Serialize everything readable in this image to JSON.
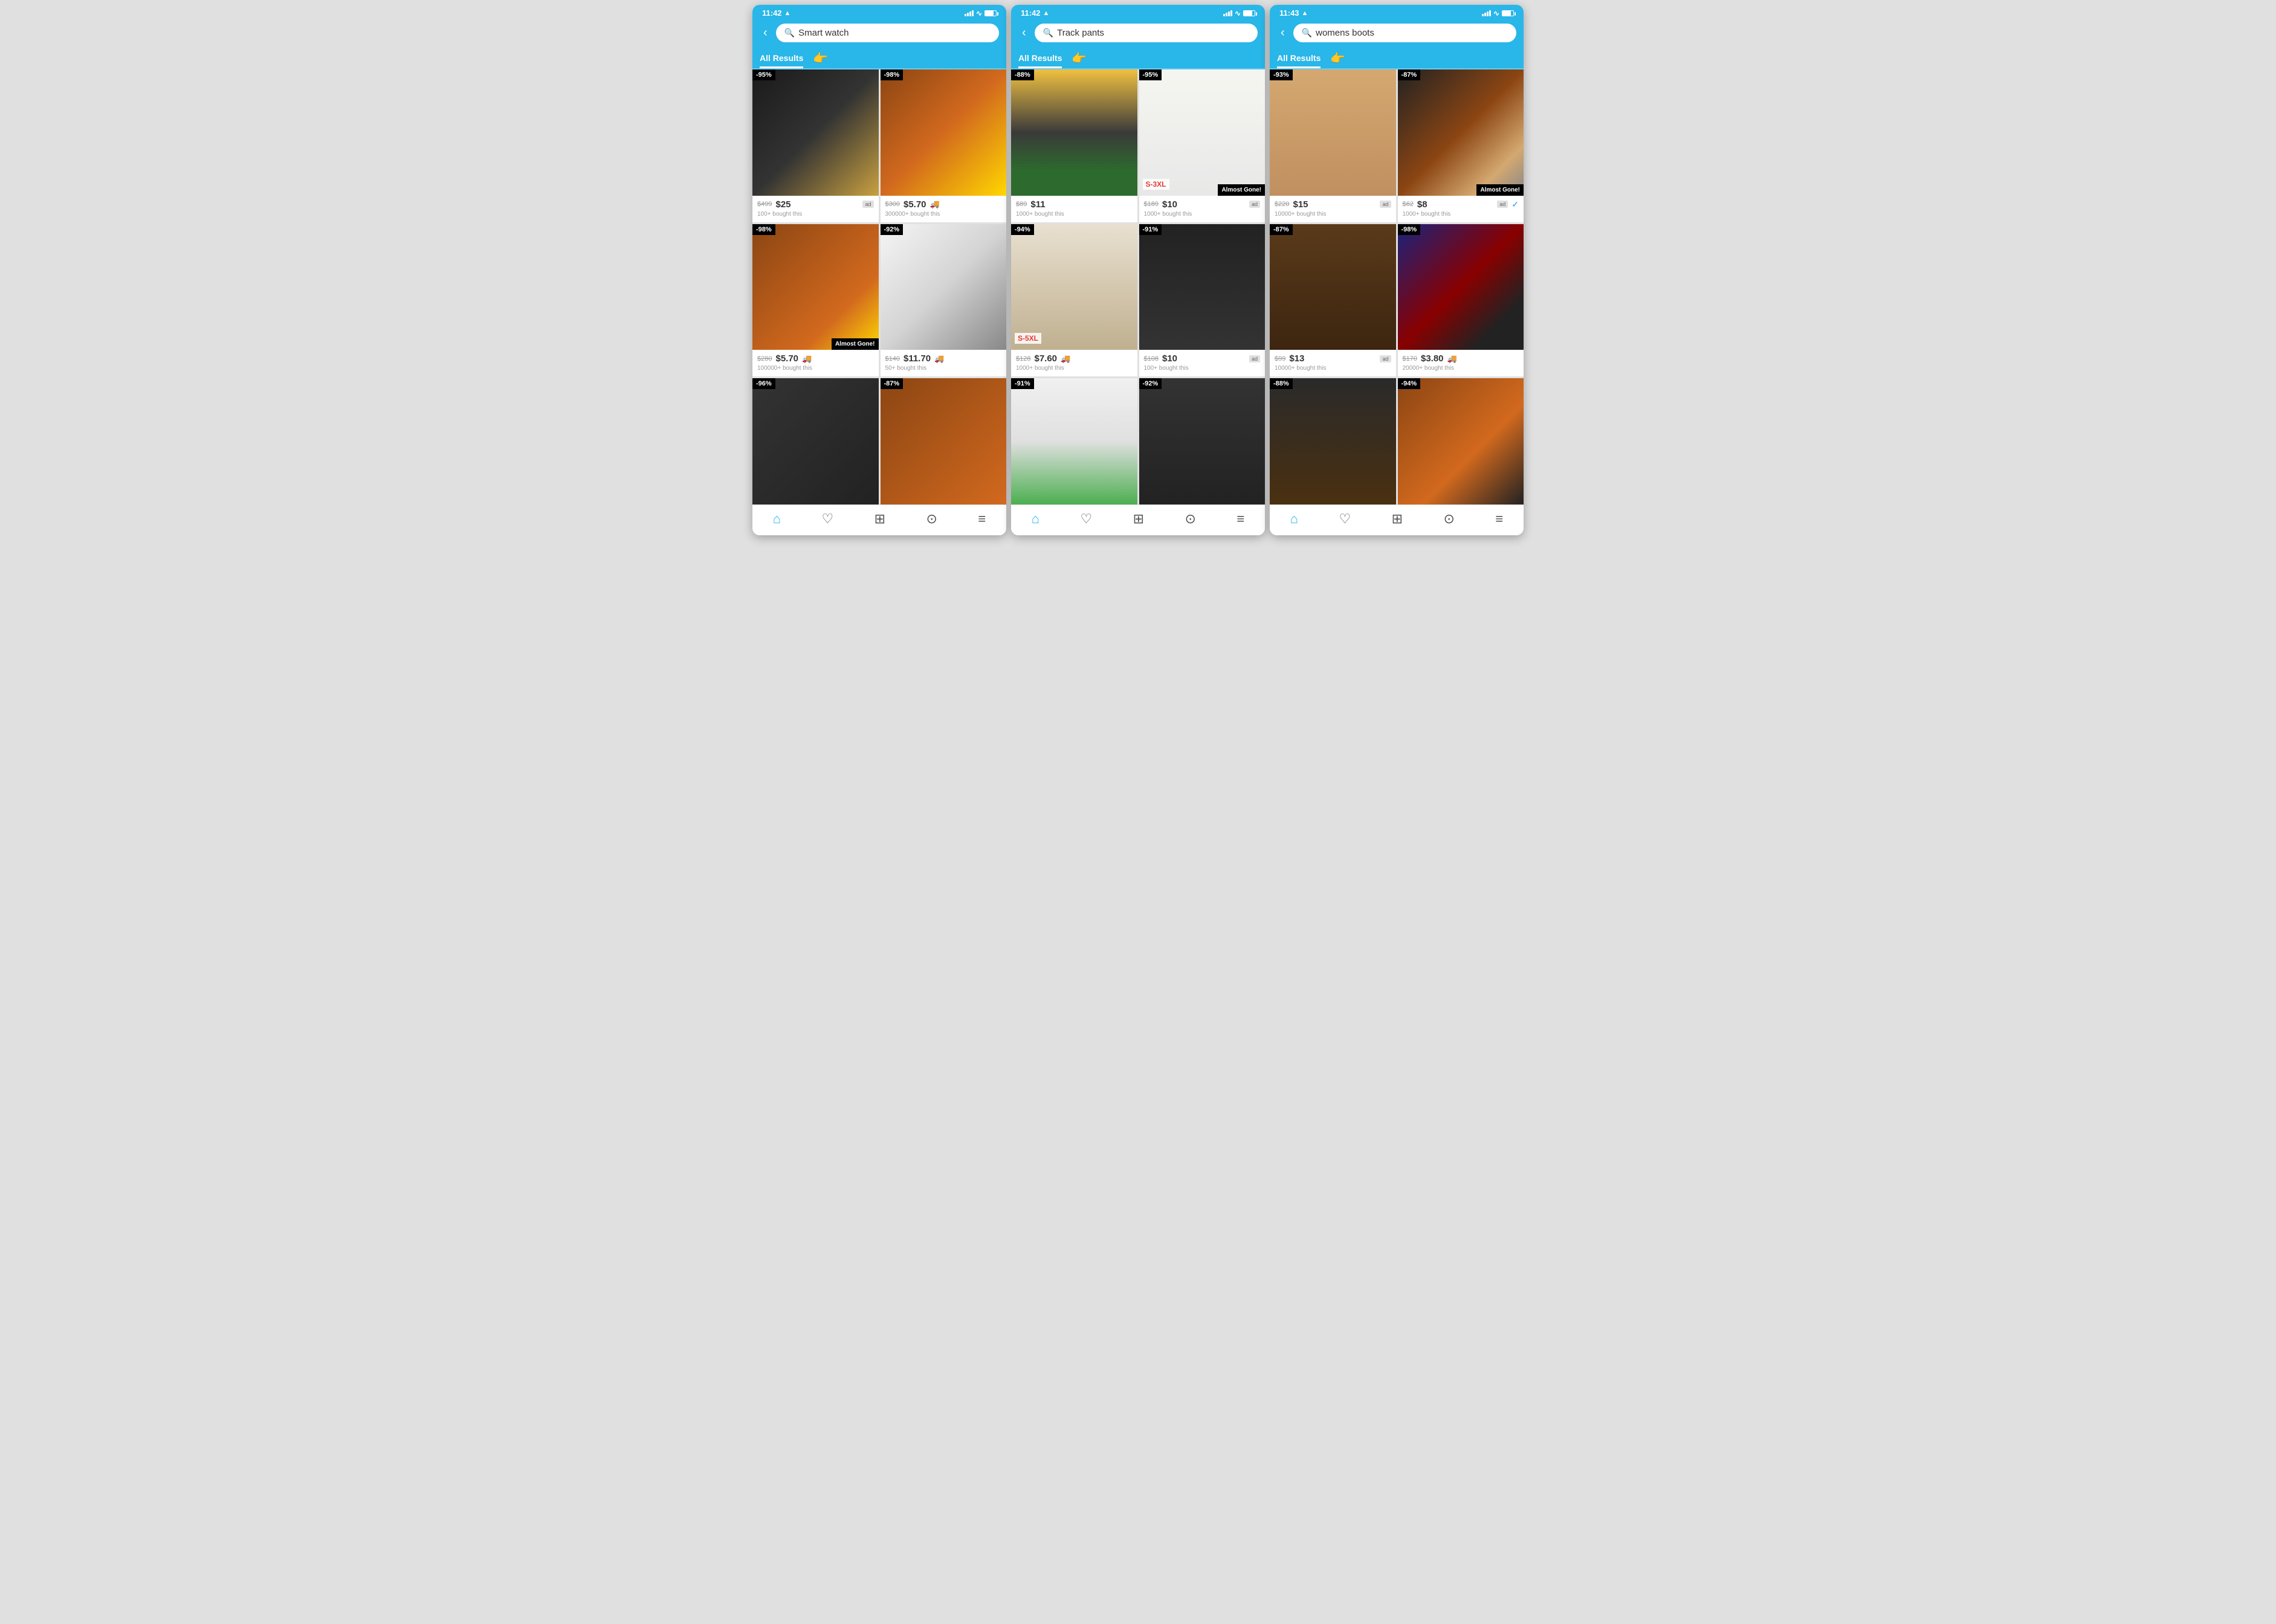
{
  "screens": [
    {
      "id": "smartwatch",
      "status_time": "11:42",
      "search_query": "Smart watch",
      "tab_label": "All Results",
      "products": [
        {
          "discount": "-95%",
          "original_price": "$499",
          "sale_price": "$25",
          "bought": "100+ bought this",
          "ad": true,
          "truck": false,
          "almost_gone": false,
          "bg": "watch-img-1"
        },
        {
          "discount": "-98%",
          "original_price": "$300",
          "sale_price": "$5.70",
          "bought": "300000+ bought this",
          "ad": false,
          "truck": true,
          "almost_gone": false,
          "bg": "watch-img-2"
        },
        {
          "discount": "-98%",
          "original_price": "$280",
          "sale_price": "$5.70",
          "bought": "100000+ bought this",
          "ad": false,
          "truck": true,
          "almost_gone": true,
          "bg": "watch-img-3"
        },
        {
          "discount": "-92%",
          "original_price": "$140",
          "sale_price": "$11.70",
          "bought": "50+ bought this",
          "ad": false,
          "truck": true,
          "almost_gone": false,
          "bg": "watch-img-4"
        },
        {
          "discount": "-96%",
          "original_price": "",
          "sale_price": "",
          "bought": "",
          "ad": false,
          "truck": false,
          "almost_gone": false,
          "bg": "watch-img-5"
        },
        {
          "discount": "-87%",
          "original_price": "",
          "sale_price": "",
          "bought": "",
          "ad": false,
          "truck": false,
          "almost_gone": false,
          "bg": "watch-img-6"
        }
      ]
    },
    {
      "id": "trackpants",
      "status_time": "11:42",
      "search_query": "Track pants",
      "tab_label": "All Results",
      "products": [
        {
          "discount": "-88%",
          "original_price": "$89",
          "sale_price": "$11",
          "bought": "1000+ bought this",
          "ad": false,
          "truck": false,
          "almost_gone": false,
          "bg": "pants-img-1"
        },
        {
          "discount": "-95%",
          "original_price": "$189",
          "sale_price": "$10",
          "bought": "1000+ bought this",
          "ad": true,
          "truck": false,
          "almost_gone": true,
          "size": "S-3XL",
          "bg": "pants-img-2"
        },
        {
          "discount": "-94%",
          "original_price": "$128",
          "sale_price": "$7.60",
          "bought": "1000+ bought this",
          "ad": false,
          "truck": true,
          "almost_gone": false,
          "size": "S-5XL",
          "bg": "pants-img-3"
        },
        {
          "discount": "-91%",
          "original_price": "$108",
          "sale_price": "$10",
          "bought": "100+ bought this",
          "ad": true,
          "truck": false,
          "almost_gone": false,
          "bg": "pants-img-4"
        },
        {
          "discount": "-91%",
          "original_price": "",
          "sale_price": "",
          "bought": "",
          "ad": false,
          "truck": false,
          "almost_gone": false,
          "bg": "pants-img-5"
        },
        {
          "discount": "-92%",
          "original_price": "",
          "sale_price": "",
          "bought": "",
          "ad": false,
          "truck": false,
          "almost_gone": false,
          "bg": "pants-img-6"
        }
      ]
    },
    {
      "id": "womenboots",
      "status_time": "11:43",
      "search_query": "womens boots",
      "tab_label": "All Results",
      "products": [
        {
          "discount": "-93%",
          "original_price": "$220",
          "sale_price": "$15",
          "bought": "10000+ bought this",
          "ad": true,
          "truck": false,
          "almost_gone": false,
          "bg": "boots-img-1"
        },
        {
          "discount": "-87%",
          "original_price": "$62",
          "sale_price": "$8",
          "bought": "1000+ bought this",
          "ad": true,
          "truck": false,
          "almost_gone": true,
          "verified": true,
          "bg": "boots-img-2"
        },
        {
          "discount": "-87%",
          "original_price": "$99",
          "sale_price": "$13",
          "bought": "10000+ bought this",
          "ad": true,
          "truck": false,
          "almost_gone": false,
          "bg": "boots-img-3"
        },
        {
          "discount": "-98%",
          "original_price": "$170",
          "sale_price": "$3.80",
          "bought": "20000+ bought this",
          "ad": false,
          "truck": true,
          "almost_gone": false,
          "bg": "boots-img-4"
        },
        {
          "discount": "-88%",
          "original_price": "",
          "sale_price": "",
          "bought": "",
          "ad": false,
          "truck": false,
          "almost_gone": false,
          "bg": "boots-img-5"
        },
        {
          "discount": "-94%",
          "original_price": "",
          "sale_price": "",
          "bought": "",
          "ad": false,
          "truck": false,
          "almost_gone": false,
          "bg": "boots-img-6"
        }
      ]
    }
  ],
  "nav_items": [
    "home",
    "heart",
    "grid",
    "cart",
    "menu"
  ]
}
